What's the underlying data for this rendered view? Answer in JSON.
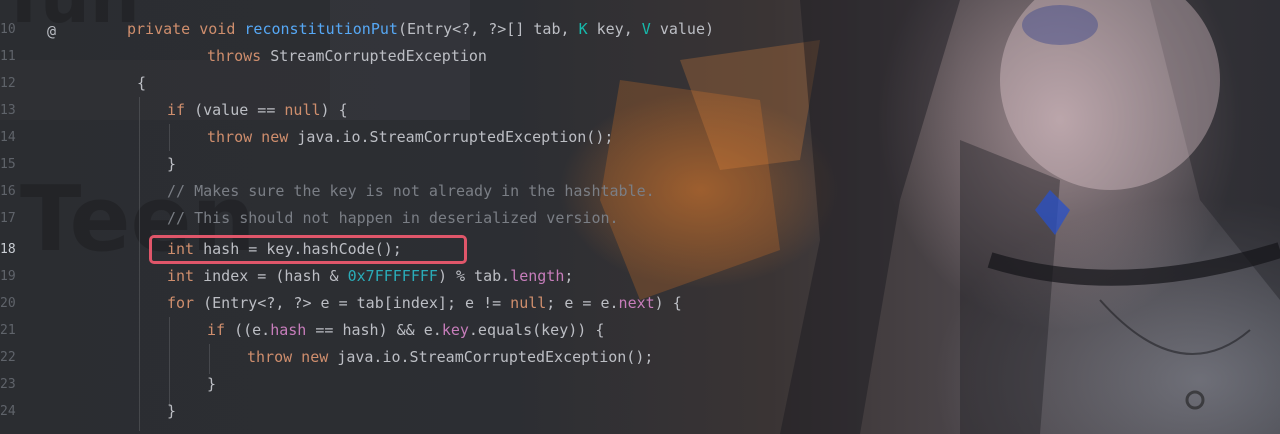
{
  "gutter": {
    "line_numbers": [
      "10",
      "11",
      "12",
      "13",
      "14",
      "15",
      "16",
      "17",
      "18",
      "19",
      "20",
      "21",
      "22",
      "23",
      "24"
    ],
    "current_line": "18",
    "annotation_marker": "@"
  },
  "code": {
    "l10": {
      "t1": "private void ",
      "t2": "reconstitutionPut",
      "t3": "(Entry<?, ?>[] tab, ",
      "t4": "K",
      "t5": " key, ",
      "t6": "V",
      "t7": " value)"
    },
    "l11": {
      "t1": "throws ",
      "t2": "StreamCorruptedException"
    },
    "l12": {
      "t1": "{"
    },
    "l13": {
      "t1": "if ",
      "t2": "(value == ",
      "t3": "null",
      "t4": ") {"
    },
    "l14": {
      "t1": "throw new ",
      "t2": "java.io.StreamCorruptedException();"
    },
    "l15": {
      "t1": "}"
    },
    "l16": {
      "t1": "// Makes sure the key is not already in the hashtable."
    },
    "l17": {
      "t1": "// This should not happen in deserialized version."
    },
    "l18": {
      "t1": "int ",
      "t2": "hash = key.hashCode();"
    },
    "l19": {
      "t1": "int ",
      "t2": "index = (hash & ",
      "t3": "0x7FFFFFFF",
      "t4": ") % tab.",
      "t5": "length",
      "t6": ";"
    },
    "l20": {
      "t1": "for ",
      "t2": "(Entry<?, ?> e = tab[index]; e != ",
      "t3": "null",
      "t4": "; e = e.",
      "t5": "next",
      "t6": ") {"
    },
    "l21": {
      "t1": "if ",
      "t2": "((e.",
      "t3": "hash",
      "t4": " == hash) && e.",
      "t5": "key",
      "t6": ".equals(key)) {"
    },
    "l22": {
      "t1": "throw new ",
      "t2": "java.io.StreamCorruptedException();"
    },
    "l23": {
      "t1": "}"
    },
    "l24": {
      "t1": "}"
    }
  },
  "colors": {
    "keyword": "#cf8e6d",
    "method": "#56a8f5",
    "type_param": "#16baac",
    "comment": "#7a7e85",
    "number": "#2aacb8",
    "field": "#c77dbb",
    "highlight_border": "#e0566a"
  }
}
